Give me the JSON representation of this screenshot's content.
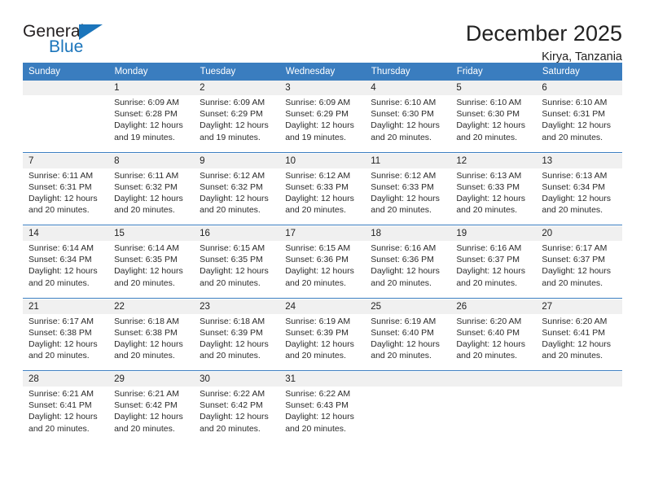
{
  "brand": {
    "name_part1": "General",
    "name_part2": "Blue",
    "accent_color": "#1b75bb",
    "logo_icon": "triangle-flag-icon"
  },
  "header": {
    "title": "December 2025",
    "subtitle": "Kirya, Tanzania"
  },
  "calendar": {
    "header_bg": "#3a7dbf",
    "daynum_bg": "#f0f0f0",
    "weekday_headers": [
      "Sunday",
      "Monday",
      "Tuesday",
      "Wednesday",
      "Thursday",
      "Friday",
      "Saturday"
    ],
    "weeks": [
      {
        "days": [
          {
            "num": "",
            "sunrise": "",
            "sunset": "",
            "daylight_line1": "",
            "daylight_line2": ""
          },
          {
            "num": "1",
            "sunrise": "Sunrise: 6:09 AM",
            "sunset": "Sunset: 6:28 PM",
            "daylight_line1": "Daylight: 12 hours",
            "daylight_line2": "and 19 minutes."
          },
          {
            "num": "2",
            "sunrise": "Sunrise: 6:09 AM",
            "sunset": "Sunset: 6:29 PM",
            "daylight_line1": "Daylight: 12 hours",
            "daylight_line2": "and 19 minutes."
          },
          {
            "num": "3",
            "sunrise": "Sunrise: 6:09 AM",
            "sunset": "Sunset: 6:29 PM",
            "daylight_line1": "Daylight: 12 hours",
            "daylight_line2": "and 19 minutes."
          },
          {
            "num": "4",
            "sunrise": "Sunrise: 6:10 AM",
            "sunset": "Sunset: 6:30 PM",
            "daylight_line1": "Daylight: 12 hours",
            "daylight_line2": "and 20 minutes."
          },
          {
            "num": "5",
            "sunrise": "Sunrise: 6:10 AM",
            "sunset": "Sunset: 6:30 PM",
            "daylight_line1": "Daylight: 12 hours",
            "daylight_line2": "and 20 minutes."
          },
          {
            "num": "6",
            "sunrise": "Sunrise: 6:10 AM",
            "sunset": "Sunset: 6:31 PM",
            "daylight_line1": "Daylight: 12 hours",
            "daylight_line2": "and 20 minutes."
          }
        ]
      },
      {
        "days": [
          {
            "num": "7",
            "sunrise": "Sunrise: 6:11 AM",
            "sunset": "Sunset: 6:31 PM",
            "daylight_line1": "Daylight: 12 hours",
            "daylight_line2": "and 20 minutes."
          },
          {
            "num": "8",
            "sunrise": "Sunrise: 6:11 AM",
            "sunset": "Sunset: 6:32 PM",
            "daylight_line1": "Daylight: 12 hours",
            "daylight_line2": "and 20 minutes."
          },
          {
            "num": "9",
            "sunrise": "Sunrise: 6:12 AM",
            "sunset": "Sunset: 6:32 PM",
            "daylight_line1": "Daylight: 12 hours",
            "daylight_line2": "and 20 minutes."
          },
          {
            "num": "10",
            "sunrise": "Sunrise: 6:12 AM",
            "sunset": "Sunset: 6:33 PM",
            "daylight_line1": "Daylight: 12 hours",
            "daylight_line2": "and 20 minutes."
          },
          {
            "num": "11",
            "sunrise": "Sunrise: 6:12 AM",
            "sunset": "Sunset: 6:33 PM",
            "daylight_line1": "Daylight: 12 hours",
            "daylight_line2": "and 20 minutes."
          },
          {
            "num": "12",
            "sunrise": "Sunrise: 6:13 AM",
            "sunset": "Sunset: 6:33 PM",
            "daylight_line1": "Daylight: 12 hours",
            "daylight_line2": "and 20 minutes."
          },
          {
            "num": "13",
            "sunrise": "Sunrise: 6:13 AM",
            "sunset": "Sunset: 6:34 PM",
            "daylight_line1": "Daylight: 12 hours",
            "daylight_line2": "and 20 minutes."
          }
        ]
      },
      {
        "days": [
          {
            "num": "14",
            "sunrise": "Sunrise: 6:14 AM",
            "sunset": "Sunset: 6:34 PM",
            "daylight_line1": "Daylight: 12 hours",
            "daylight_line2": "and 20 minutes."
          },
          {
            "num": "15",
            "sunrise": "Sunrise: 6:14 AM",
            "sunset": "Sunset: 6:35 PM",
            "daylight_line1": "Daylight: 12 hours",
            "daylight_line2": "and 20 minutes."
          },
          {
            "num": "16",
            "sunrise": "Sunrise: 6:15 AM",
            "sunset": "Sunset: 6:35 PM",
            "daylight_line1": "Daylight: 12 hours",
            "daylight_line2": "and 20 minutes."
          },
          {
            "num": "17",
            "sunrise": "Sunrise: 6:15 AM",
            "sunset": "Sunset: 6:36 PM",
            "daylight_line1": "Daylight: 12 hours",
            "daylight_line2": "and 20 minutes."
          },
          {
            "num": "18",
            "sunrise": "Sunrise: 6:16 AM",
            "sunset": "Sunset: 6:36 PM",
            "daylight_line1": "Daylight: 12 hours",
            "daylight_line2": "and 20 minutes."
          },
          {
            "num": "19",
            "sunrise": "Sunrise: 6:16 AM",
            "sunset": "Sunset: 6:37 PM",
            "daylight_line1": "Daylight: 12 hours",
            "daylight_line2": "and 20 minutes."
          },
          {
            "num": "20",
            "sunrise": "Sunrise: 6:17 AM",
            "sunset": "Sunset: 6:37 PM",
            "daylight_line1": "Daylight: 12 hours",
            "daylight_line2": "and 20 minutes."
          }
        ]
      },
      {
        "days": [
          {
            "num": "21",
            "sunrise": "Sunrise: 6:17 AM",
            "sunset": "Sunset: 6:38 PM",
            "daylight_line1": "Daylight: 12 hours",
            "daylight_line2": "and 20 minutes."
          },
          {
            "num": "22",
            "sunrise": "Sunrise: 6:18 AM",
            "sunset": "Sunset: 6:38 PM",
            "daylight_line1": "Daylight: 12 hours",
            "daylight_line2": "and 20 minutes."
          },
          {
            "num": "23",
            "sunrise": "Sunrise: 6:18 AM",
            "sunset": "Sunset: 6:39 PM",
            "daylight_line1": "Daylight: 12 hours",
            "daylight_line2": "and 20 minutes."
          },
          {
            "num": "24",
            "sunrise": "Sunrise: 6:19 AM",
            "sunset": "Sunset: 6:39 PM",
            "daylight_line1": "Daylight: 12 hours",
            "daylight_line2": "and 20 minutes."
          },
          {
            "num": "25",
            "sunrise": "Sunrise: 6:19 AM",
            "sunset": "Sunset: 6:40 PM",
            "daylight_line1": "Daylight: 12 hours",
            "daylight_line2": "and 20 minutes."
          },
          {
            "num": "26",
            "sunrise": "Sunrise: 6:20 AM",
            "sunset": "Sunset: 6:40 PM",
            "daylight_line1": "Daylight: 12 hours",
            "daylight_line2": "and 20 minutes."
          },
          {
            "num": "27",
            "sunrise": "Sunrise: 6:20 AM",
            "sunset": "Sunset: 6:41 PM",
            "daylight_line1": "Daylight: 12 hours",
            "daylight_line2": "and 20 minutes."
          }
        ]
      },
      {
        "days": [
          {
            "num": "28",
            "sunrise": "Sunrise: 6:21 AM",
            "sunset": "Sunset: 6:41 PM",
            "daylight_line1": "Daylight: 12 hours",
            "daylight_line2": "and 20 minutes."
          },
          {
            "num": "29",
            "sunrise": "Sunrise: 6:21 AM",
            "sunset": "Sunset: 6:42 PM",
            "daylight_line1": "Daylight: 12 hours",
            "daylight_line2": "and 20 minutes."
          },
          {
            "num": "30",
            "sunrise": "Sunrise: 6:22 AM",
            "sunset": "Sunset: 6:42 PM",
            "daylight_line1": "Daylight: 12 hours",
            "daylight_line2": "and 20 minutes."
          },
          {
            "num": "31",
            "sunrise": "Sunrise: 6:22 AM",
            "sunset": "Sunset: 6:43 PM",
            "daylight_line1": "Daylight: 12 hours",
            "daylight_line2": "and 20 minutes."
          },
          {
            "num": "",
            "sunrise": "",
            "sunset": "",
            "daylight_line1": "",
            "daylight_line2": ""
          },
          {
            "num": "",
            "sunrise": "",
            "sunset": "",
            "daylight_line1": "",
            "daylight_line2": ""
          },
          {
            "num": "",
            "sunrise": "",
            "sunset": "",
            "daylight_line1": "",
            "daylight_line2": ""
          }
        ]
      }
    ]
  }
}
